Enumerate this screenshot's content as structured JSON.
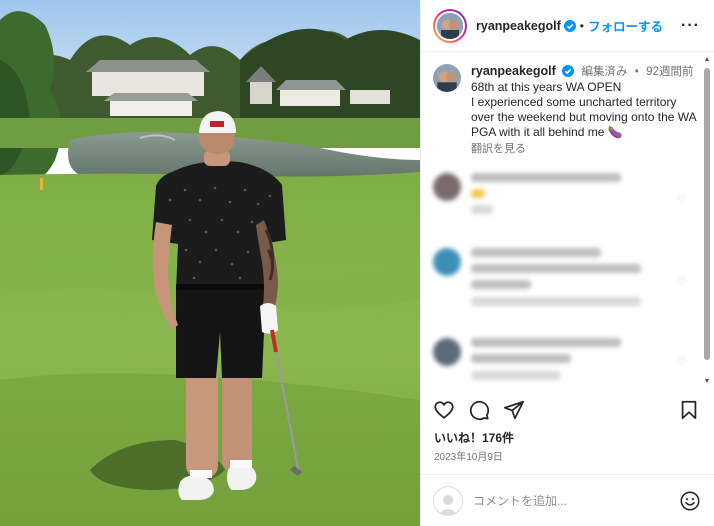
{
  "header": {
    "username": "ryanpeakegolf",
    "separator": "•",
    "follow_label": "フォローする",
    "more_label": "···"
  },
  "caption": {
    "username": "ryanpeakegolf",
    "edited": "編集済み",
    "separator": "•",
    "age": "92週間前",
    "line1": "68th at this years WA OPEN",
    "line2": "I experienced some uncharted territory over the weekend but moving onto the WA PGA with it all behind me 🍆",
    "translate": "翻訳を見る"
  },
  "actions": {
    "likes": "いいね！176件",
    "date": "2023年10月9日"
  },
  "comment_input": {
    "placeholder": "コメントを追加..."
  },
  "colors": {
    "accent": "#0095f6",
    "text": "#262626",
    "muted": "#737373",
    "divider": "#efefef"
  },
  "icons": [
    "verified-icon",
    "more-icon",
    "heart-icon",
    "comment-icon",
    "share-icon",
    "save-icon",
    "emoji-icon"
  ]
}
